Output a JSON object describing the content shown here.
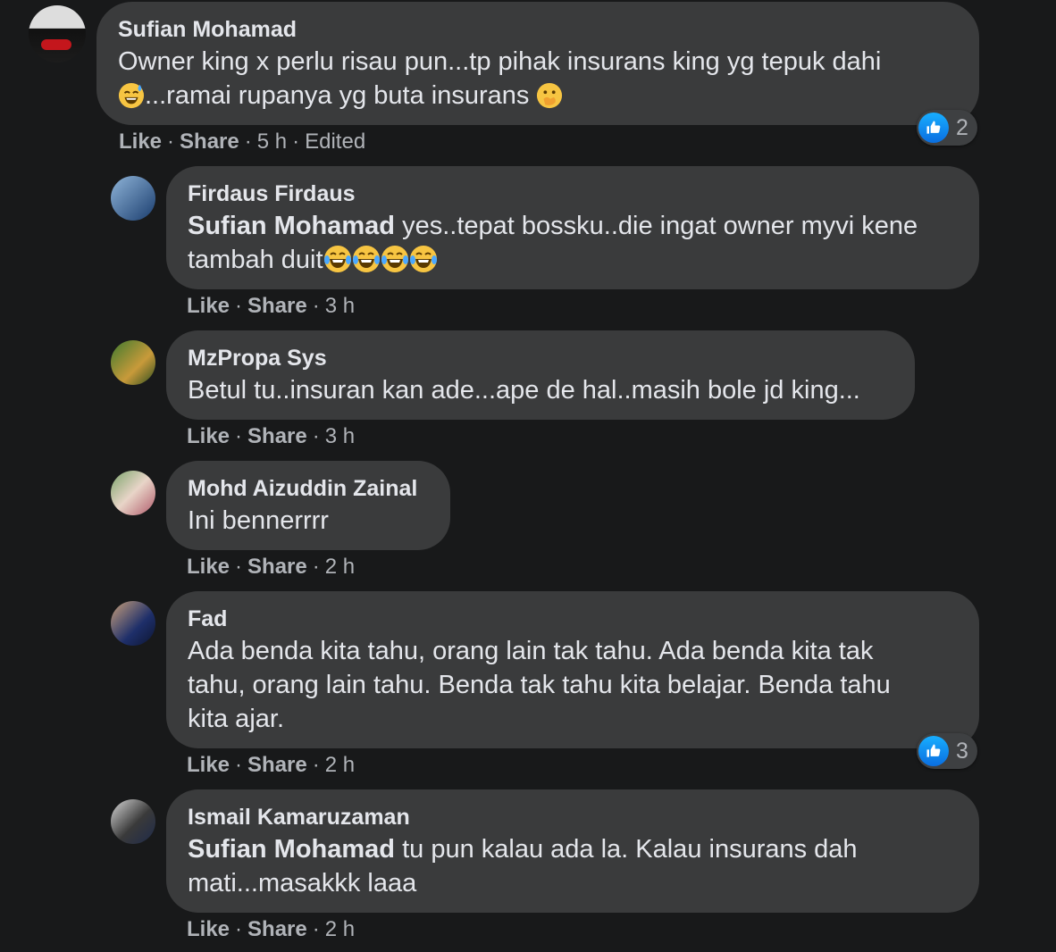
{
  "comments": [
    {
      "author": "Sufian Mohamad",
      "line1": "Owner king x perlu risau pun...tp pihak insurans king yg tepuk dahi",
      "line2": "...ramai rupanya yg buta insurans",
      "like": "Like",
      "share": "Share",
      "time": "5 h",
      "edited": "Edited",
      "reaction_count": "2",
      "emojis": [
        "sweat-smile-emoji",
        "hand-over-mouth-emoji"
      ]
    },
    {
      "author": "Firdaus Firdaus",
      "mention": "Sufian Mohamad",
      "line1": " yes..tepat bossku..die ingat owner myvi kene",
      "line2": "tambah duit",
      "like": "Like",
      "share": "Share",
      "time": "3 h",
      "emojis": [
        "tears-of-joy-emoji",
        "tears-of-joy-emoji",
        "tears-of-joy-emoji",
        "tears-of-joy-emoji"
      ]
    },
    {
      "author": "MzPropa Sys",
      "line1": "Betul tu..insuran kan ade...ape de hal..masih bole jd king...",
      "like": "Like",
      "share": "Share",
      "time": "3 h"
    },
    {
      "author": "Mohd Aizuddin Zainal",
      "line1": "Ini bennerrrr",
      "like": "Like",
      "share": "Share",
      "time": "2 h"
    },
    {
      "author": "Fad",
      "line1": "Ada benda kita tahu, orang lain tak tahu. Ada benda kita tak",
      "line2": "tahu, orang lain tahu. Benda tak tahu kita belajar. Benda tahu",
      "line3": "kita ajar.",
      "like": "Like",
      "share": "Share",
      "time": "2 h",
      "reaction_count": "3"
    },
    {
      "author": "Ismail Kamaruzaman",
      "mention": "Sufian Mohamad",
      "line1": " tu pun kalau ada la. Kalau insurans dah",
      "line2": "mati...masakkk laaa",
      "like": "Like",
      "share": "Share",
      "time": "2 h"
    }
  ],
  "colors": {
    "background": "#18191a",
    "bubble": "#3a3b3c",
    "text": "#e4e6eb",
    "secondary": "#b0b3b8",
    "like_blue": "#0a6ee0"
  }
}
